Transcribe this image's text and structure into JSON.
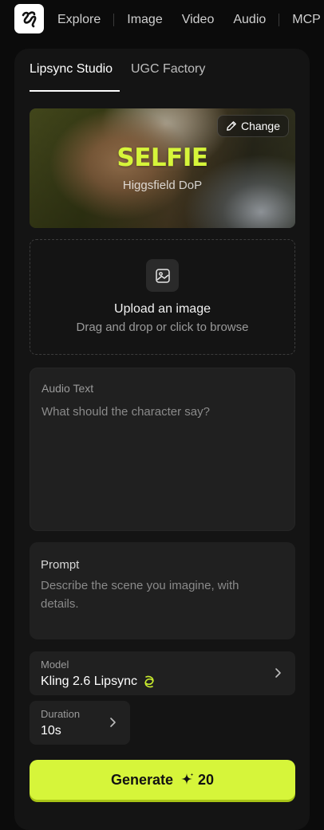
{
  "nav": {
    "items": [
      "Explore",
      "Image",
      "Video",
      "Audio",
      "MCP"
    ]
  },
  "tabs": [
    {
      "label": "Lipsync Studio",
      "active": true
    },
    {
      "label": "UGC Factory",
      "active": false
    }
  ],
  "preset": {
    "title": "SELFIE",
    "subtitle": "Higgsfield DoP",
    "change_label": "Change"
  },
  "upload": {
    "title": "Upload an image",
    "subtitle": "Drag and drop or click to browse"
  },
  "audio": {
    "label": "Audio Text",
    "placeholder": "What should the character say?"
  },
  "prompt": {
    "label": "Prompt",
    "placeholder": "Describe the scene you imagine, with details."
  },
  "model": {
    "label": "Model",
    "value": "Kling 2.6 Lipsync"
  },
  "duration": {
    "label": "Duration",
    "value": "10s"
  },
  "generate": {
    "label": "Generate",
    "cost": "20"
  },
  "colors": {
    "accent": "#d6f53a",
    "panel": "#141414",
    "field": "#202020",
    "background": "#0b0b0b"
  }
}
